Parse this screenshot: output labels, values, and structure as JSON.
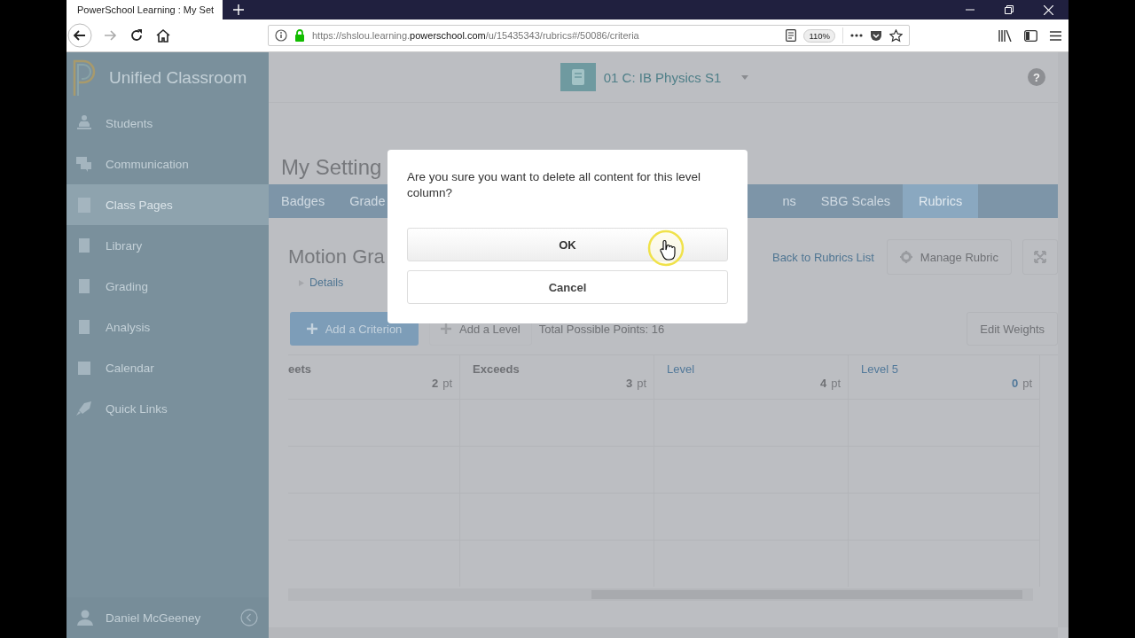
{
  "browser": {
    "tab_title": "PowerSchool Learning : My Set",
    "url_parts": [
      "https://shslou.learning.",
      "powerschool.com",
      "/u/15435343/rubrics#/50086/criteria"
    ],
    "zoom": "110%"
  },
  "sidebar": {
    "title": "Unified Classroom",
    "items": [
      {
        "label": "Students",
        "selected": false
      },
      {
        "label": "Communication",
        "selected": false
      },
      {
        "label": "Class Pages",
        "selected": true
      },
      {
        "label": "Library",
        "selected": false
      },
      {
        "label": "Grading",
        "selected": false
      },
      {
        "label": "Analysis",
        "selected": false
      },
      {
        "label": "Calendar",
        "selected": false
      },
      {
        "label": "Quick Links",
        "selected": false
      }
    ],
    "user": "Daniel McGeeney"
  },
  "header": {
    "course": "01 C: IB Physics S1",
    "help": "?"
  },
  "page_title": "My Setting",
  "tabs": [
    {
      "label": "Badges",
      "selected": false
    },
    {
      "label": "Grade",
      "selected": false
    },
    {
      "label": "ns",
      "selected": false
    },
    {
      "label": "SBG Scales",
      "selected": false
    },
    {
      "label": "Rubrics",
      "selected": true
    }
  ],
  "rubric": {
    "title": "Motion Gra",
    "details": "Details",
    "back_link": "Back to Rubrics List",
    "manage": "Manage Rubric"
  },
  "actions": {
    "add_criterion": "Add a Criterion",
    "add_level": "Add a Level",
    "total": "Total Possible Points: 16",
    "edit_weights": "Edit Weights"
  },
  "table": {
    "columns": [
      {
        "label": "eets",
        "points": "2",
        "unit": "pt",
        "highlighted": false
      },
      {
        "label": "Exceeds",
        "points": "3",
        "unit": "pt",
        "highlighted": false
      },
      {
        "label": "Level",
        "points": "4",
        "unit": "pt",
        "highlighted": true
      },
      {
        "label": "Level 5",
        "points": "0",
        "unit": "pt",
        "highlighted": true
      }
    ]
  },
  "dialog": {
    "message": "Are you sure you want to delete all content for this level column?",
    "buttons": [
      {
        "label": "OK",
        "kind": "primary"
      },
      {
        "label": "Cancel",
        "kind": "secondary"
      }
    ]
  }
}
